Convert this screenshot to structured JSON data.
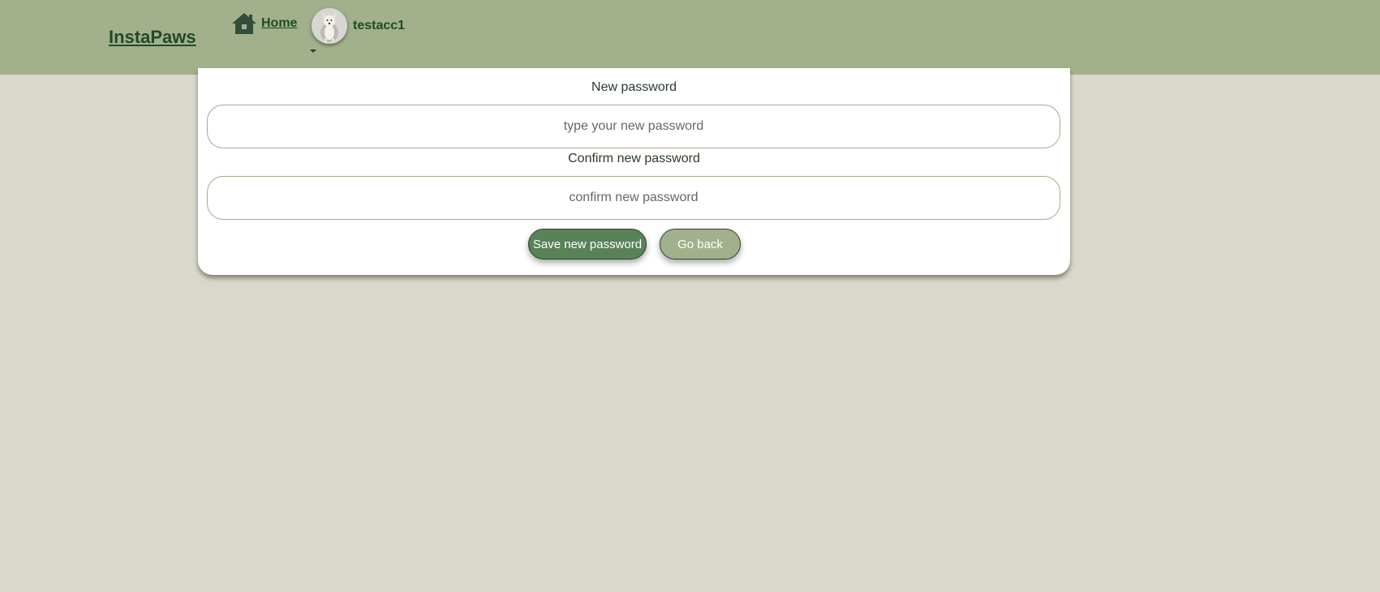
{
  "navbar": {
    "brand": "InstaPaws",
    "home_label": "Home",
    "home_icon": "house-icon",
    "username": "testacc1",
    "avatar_alt": "dog-avatar",
    "dropdown_icon": "caret-down-icon",
    "background_color": "#a2b18b"
  },
  "form": {
    "new_password": {
      "label": "New password",
      "placeholder": "type your new password",
      "value": ""
    },
    "confirm_password": {
      "label": "Confirm new password",
      "placeholder": "confirm new password",
      "value": ""
    },
    "save_button": "Save new password",
    "back_button": "Go back"
  },
  "colors": {
    "page_background": "#dad8cb",
    "brand_text": "#1f4a2a",
    "save_button": "#5a8258",
    "back_button": "#a2b18b"
  }
}
